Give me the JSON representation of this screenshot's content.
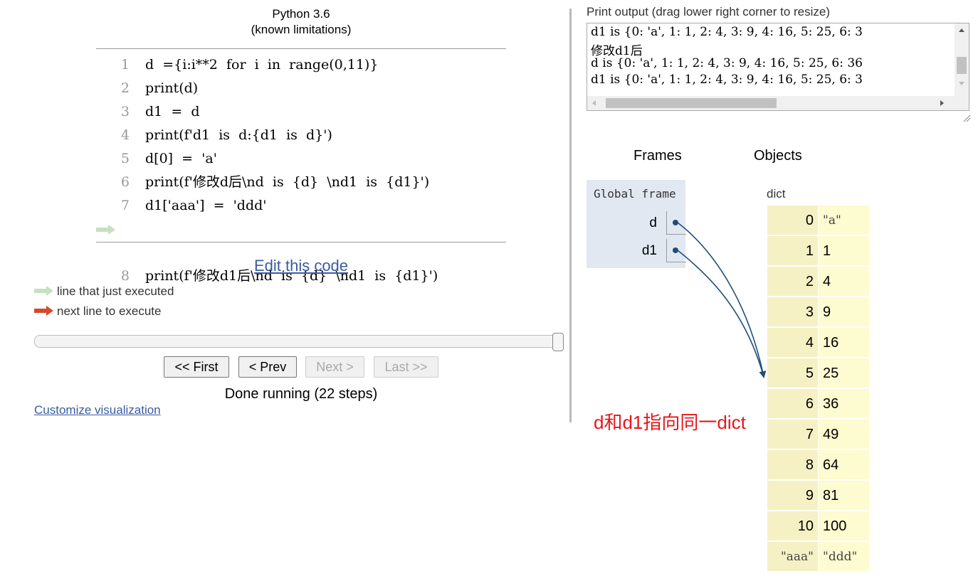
{
  "header": {
    "title": "Python 3.6",
    "limitations_open": "(",
    "limitations_link": "known limitations",
    "limitations_close": ")"
  },
  "code_lines": [
    {
      "num": "1",
      "text": "d  ={i:i**2  for  i  in  range(0,11)}"
    },
    {
      "num": "2",
      "text": "print(d)"
    },
    {
      "num": "3",
      "text": "d1  =  d"
    },
    {
      "num": "4",
      "text": "print(f'd1  is  d:{d1  is  d}')"
    },
    {
      "num": "5",
      "text": "d[0]  =  'a'"
    },
    {
      "num": "6",
      "text": "print(f'修改d后\\nd  is  {d}  \\nd1  is  {d1}')"
    },
    {
      "num": "7",
      "text": "d1['aaa']  =  'ddd'"
    },
    {
      "num": "8",
      "text": "print(f'修改d1后\\nd  is  {d}  \\nd1  is  {d1}')"
    }
  ],
  "edit_link": "Edit this code",
  "legend": {
    "just_executed": "line that just executed",
    "next_line": "next line to execute",
    "green": "#c6e0c0",
    "red": "#d9472b"
  },
  "navigation": {
    "first": "<< First",
    "prev": "< Prev",
    "next": "Next >",
    "last": "Last >>",
    "status": "Done running (22 steps)",
    "step_progress": 1.0
  },
  "customize_link": "Customize visualization",
  "print_output": {
    "label": "Print output (drag lower right corner to resize)",
    "lines": [
      "d1 is {0: 'a', 1: 1, 2: 4, 3: 9, 4: 16, 5: 25, 6: 3",
      "修改d1后",
      "d is {0: 'a', 1: 1, 2: 4, 3: 9, 4: 16, 5: 25, 6: 36",
      "d1 is {0: 'a', 1: 1, 2: 4, 3: 9, 4: 16, 5: 25, 6: 3"
    ]
  },
  "frames": {
    "heading": "Frames",
    "global_frame": "Global frame",
    "vars": [
      "d",
      "d1"
    ]
  },
  "objects": {
    "heading": "Objects",
    "type_label": "dict",
    "entries": [
      {
        "key": "0",
        "value": "\"a\"",
        "value_is_str": true
      },
      {
        "key": "1",
        "value": "1"
      },
      {
        "key": "2",
        "value": "4"
      },
      {
        "key": "3",
        "value": "9"
      },
      {
        "key": "4",
        "value": "16"
      },
      {
        "key": "5",
        "value": "25"
      },
      {
        "key": "6",
        "value": "36"
      },
      {
        "key": "7",
        "value": "49"
      },
      {
        "key": "8",
        "value": "64"
      },
      {
        "key": "9",
        "value": "81"
      },
      {
        "key": "10",
        "value": "100"
      },
      {
        "key": "\"aaa\"",
        "key_is_str": true,
        "value": "\"ddd\"",
        "value_is_str": true
      }
    ]
  },
  "annotation": "d和d1指向同一dict"
}
